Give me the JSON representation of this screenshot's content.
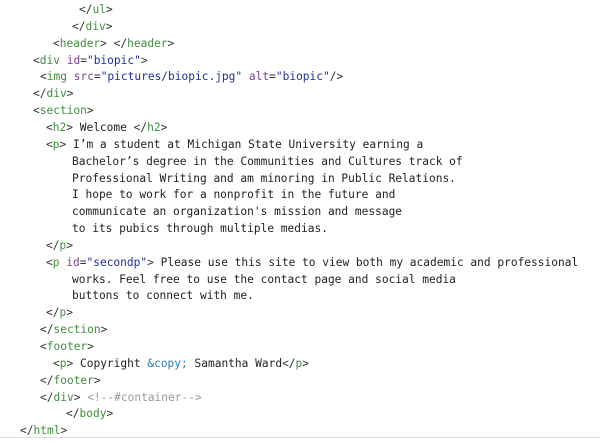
{
  "colors": {
    "tag": "#3f8f3f",
    "attr": "#7b3f9e",
    "string": "#1f2f9a",
    "entity": "#2b7bb9",
    "comment": "#999999",
    "text": "#222222"
  },
  "code_lines": [
    [
      [
        "punct",
        "</"
      ],
      [
        "tag",
        "ul"
      ],
      [
        "punct",
        ">"
      ]
    ],
    [
      [
        "punct",
        "</"
      ],
      [
        "tag",
        "div"
      ],
      [
        "punct",
        ">"
      ]
    ],
    [
      [
        "punct",
        "<"
      ],
      [
        "tag",
        "header"
      ],
      [
        "punct",
        "> </"
      ],
      [
        "tag",
        "header"
      ],
      [
        "punct",
        ">"
      ]
    ],
    [
      [
        "punct",
        "<"
      ],
      [
        "tag",
        "div"
      ],
      [
        "text",
        " "
      ],
      [
        "attr",
        "id"
      ],
      [
        "punct",
        "="
      ],
      [
        "str",
        "\"biopic\""
      ],
      [
        "punct",
        ">"
      ]
    ],
    [
      [
        "punct",
        "<"
      ],
      [
        "tag",
        "img"
      ],
      [
        "text",
        " "
      ],
      [
        "attr",
        "src"
      ],
      [
        "punct",
        "="
      ],
      [
        "str",
        "\"pictures/biopic.jpg\""
      ],
      [
        "text",
        " "
      ],
      [
        "attr",
        "alt"
      ],
      [
        "punct",
        "="
      ],
      [
        "str",
        "\"biopic\""
      ],
      [
        "punct",
        "/>"
      ]
    ],
    [
      [
        "punct",
        "</"
      ],
      [
        "tag",
        "div"
      ],
      [
        "punct",
        ">"
      ]
    ],
    [
      [
        "punct",
        "<"
      ],
      [
        "tag",
        "section"
      ],
      [
        "punct",
        ">"
      ]
    ],
    [
      [
        "punct",
        "<"
      ],
      [
        "tag",
        "h2"
      ],
      [
        "punct",
        ">"
      ],
      [
        "text",
        " Welcome "
      ],
      [
        "punct",
        "</"
      ],
      [
        "tag",
        "h2"
      ],
      [
        "punct",
        ">"
      ]
    ],
    [
      [
        "punct",
        "<"
      ],
      [
        "tag",
        "p"
      ],
      [
        "punct",
        ">"
      ],
      [
        "text",
        " I’m a student at Michigan State University earning a"
      ]
    ],
    [
      [
        "text",
        "Bachelor’s degree in the Communities and Cultures track of"
      ]
    ],
    [
      [
        "text",
        "Professional Writing and am minoring in Public Relations."
      ]
    ],
    [
      [
        "text",
        "I hope to work for a nonprofit in the future and"
      ]
    ],
    [
      [
        "text",
        "communicate an organization's mission and message"
      ]
    ],
    [
      [
        "text",
        "to its pubics through multiple medias."
      ]
    ],
    [
      [
        "punct",
        "</"
      ],
      [
        "tag",
        "p"
      ],
      [
        "punct",
        ">"
      ]
    ],
    [
      [
        "punct",
        "<"
      ],
      [
        "tag",
        "p"
      ],
      [
        "text",
        " "
      ],
      [
        "attr",
        "id"
      ],
      [
        "punct",
        "="
      ],
      [
        "str",
        "\"secondp\""
      ],
      [
        "punct",
        ">"
      ],
      [
        "text",
        " Please use this site to view both my academic and professional"
      ]
    ],
    [
      [
        "text",
        "works. Feel free to use the contact page and social media"
      ]
    ],
    [
      [
        "text",
        "buttons to connect with me."
      ]
    ],
    [
      [
        "punct",
        "</"
      ],
      [
        "tag",
        "p"
      ],
      [
        "punct",
        ">"
      ]
    ],
    [
      [
        "punct",
        "</"
      ],
      [
        "tag",
        "section"
      ],
      [
        "punct",
        ">"
      ]
    ],
    [
      [
        "punct",
        "<"
      ],
      [
        "tag",
        "footer"
      ],
      [
        "punct",
        ">"
      ]
    ],
    [
      [
        "punct",
        "<"
      ],
      [
        "tag",
        "p"
      ],
      [
        "punct",
        ">"
      ],
      [
        "text",
        " Copyright "
      ],
      [
        "entity",
        "&copy;"
      ],
      [
        "text",
        " Samantha Ward"
      ],
      [
        "punct",
        "</"
      ],
      [
        "tag",
        "p"
      ],
      [
        "punct",
        ">"
      ]
    ],
    [
      [
        "punct",
        "</"
      ],
      [
        "tag",
        "footer"
      ],
      [
        "punct",
        ">"
      ]
    ],
    [
      [
        "punct",
        "</"
      ],
      [
        "tag",
        "div"
      ],
      [
        "punct",
        ">"
      ],
      [
        "text",
        " "
      ],
      [
        "comment",
        "<!--#container-->"
      ]
    ],
    [
      [
        "punct",
        "</"
      ],
      [
        "tag",
        "body"
      ],
      [
        "punct",
        ">"
      ]
    ],
    [
      [
        "punct",
        "</"
      ],
      [
        "tag",
        "html"
      ],
      [
        "punct",
        ">"
      ]
    ]
  ]
}
